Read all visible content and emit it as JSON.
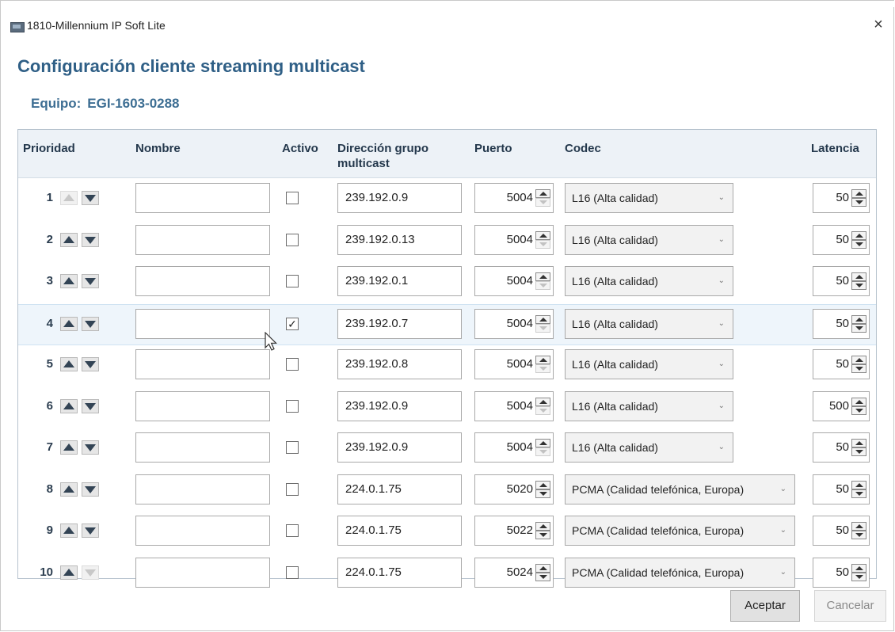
{
  "window": {
    "title": "1810-Millennium IP Soft Lite",
    "close_glyph": "×"
  },
  "page": {
    "title": "Configuración cliente streaming multicast",
    "equipo_label": "Equipo:",
    "equipo_value": "EGI-1603-0288"
  },
  "columns": {
    "prioridad": "Prioridad",
    "nombre": "Nombre",
    "activo": "Activo",
    "direccion_l1": "Dirección grupo",
    "direccion_l2": "multicast",
    "puerto": "Puerto",
    "codec": "Codec",
    "latencia": "Latencia"
  },
  "rows": [
    {
      "prioridad": "1",
      "nombre": "",
      "activo": false,
      "direccion": "239.192.0.9",
      "puerto": "5004",
      "codec": "L16 (Alta calidad)",
      "latencia": "50",
      "up_enabled": false,
      "down_enabled": true
    },
    {
      "prioridad": "2",
      "nombre": "",
      "activo": false,
      "direccion": "239.192.0.13",
      "puerto": "5004",
      "codec": "L16 (Alta calidad)",
      "latencia": "50",
      "up_enabled": true,
      "down_enabled": true
    },
    {
      "prioridad": "3",
      "nombre": "",
      "activo": false,
      "direccion": "239.192.0.1",
      "puerto": "5004",
      "codec": "L16 (Alta calidad)",
      "latencia": "50",
      "up_enabled": true,
      "down_enabled": true
    },
    {
      "prioridad": "4",
      "nombre": "",
      "activo": true,
      "direccion": "239.192.0.7",
      "puerto": "5004",
      "codec": "L16 (Alta calidad)",
      "latencia": "50",
      "up_enabled": true,
      "down_enabled": true,
      "selected": true
    },
    {
      "prioridad": "5",
      "nombre": "",
      "activo": false,
      "direccion": "239.192.0.8",
      "puerto": "5004",
      "codec": "L16 (Alta calidad)",
      "latencia": "50",
      "up_enabled": true,
      "down_enabled": true
    },
    {
      "prioridad": "6",
      "nombre": "",
      "activo": false,
      "direccion": "239.192.0.9",
      "puerto": "5004",
      "codec": "L16 (Alta calidad)",
      "latencia": "500",
      "up_enabled": true,
      "down_enabled": true
    },
    {
      "prioridad": "7",
      "nombre": "",
      "activo": false,
      "direccion": "239.192.0.9",
      "puerto": "5004",
      "codec": "L16 (Alta calidad)",
      "latencia": "50",
      "up_enabled": true,
      "down_enabled": true
    },
    {
      "prioridad": "8",
      "nombre": "",
      "activo": false,
      "direccion": "224.0.1.75",
      "puerto": "5020",
      "codec": "PCMA (Calidad telefónica, Europa)",
      "latencia": "50",
      "up_enabled": true,
      "down_enabled": true
    },
    {
      "prioridad": "9",
      "nombre": "",
      "activo": false,
      "direccion": "224.0.1.75",
      "puerto": "5022",
      "codec": "PCMA (Calidad telefónica, Europa)",
      "latencia": "50",
      "up_enabled": true,
      "down_enabled": true
    },
    {
      "prioridad": "10",
      "nombre": "",
      "activo": false,
      "direccion": "224.0.1.75",
      "puerto": "5024",
      "codec": "PCMA (Calidad telefónica, Europa)",
      "latencia": "50",
      "up_enabled": true,
      "down_enabled": false
    }
  ],
  "buttons": {
    "aceptar": "Aceptar",
    "cancelar": "Cancelar"
  },
  "icons": {
    "app": "app-window-icon",
    "close": "close-icon",
    "up": "arrow-up-icon",
    "down": "arrow-down-icon",
    "spinner": "spinner-icon",
    "dropdown": "chevron-down-icon",
    "cursor": "mouse-pointer-icon"
  },
  "colors": {
    "title": "#2f5f86",
    "header_bg": "#edf2f7",
    "selected_row": "#eef5fb"
  }
}
